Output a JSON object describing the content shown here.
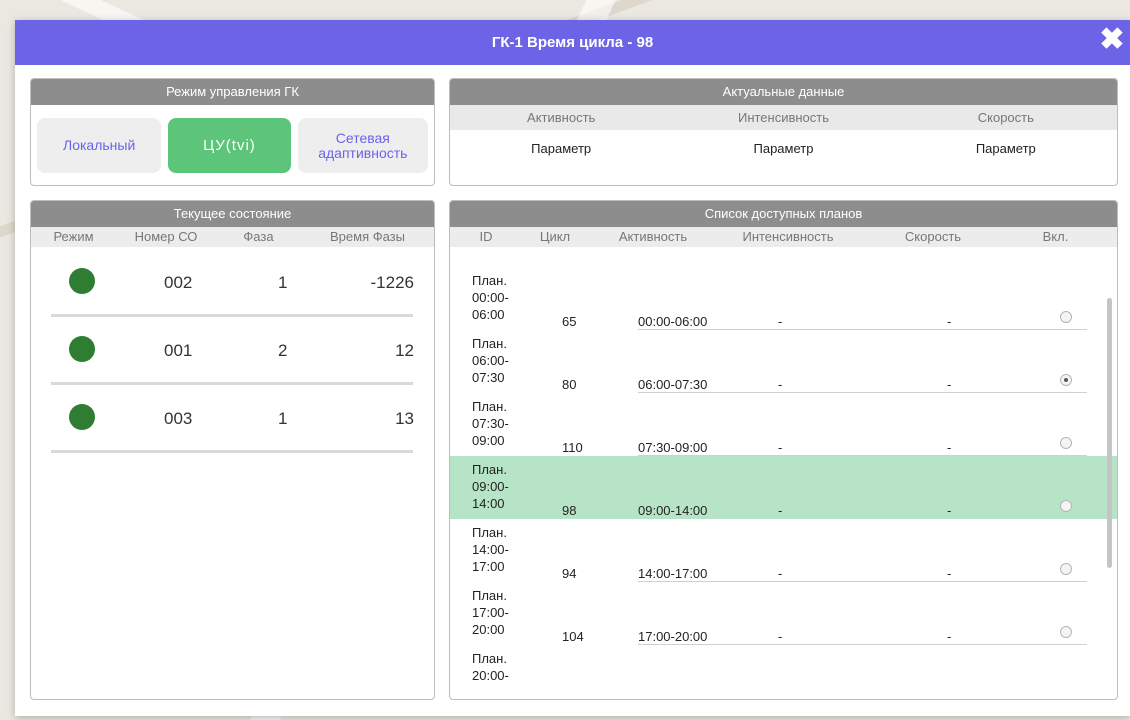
{
  "window": {
    "title": "ГК-1 Время цикла - 98",
    "close_glyph": "✖"
  },
  "mode": {
    "title": "Режим управления ГК",
    "buttons": [
      "Локальный",
      "ЦУ(tvi)",
      "Сетевая адаптивность"
    ],
    "active_index": 1
  },
  "actual": {
    "title": "Актуальные данные",
    "columns": [
      "Активность",
      "Интенсивность",
      "Скорость"
    ],
    "values": [
      "Параметр",
      "Параметр",
      "Параметр"
    ]
  },
  "state": {
    "title": "Текущее состояние",
    "columns": [
      "Режим",
      "Номер СО",
      "Фаза",
      "Время Фазы"
    ],
    "rows": [
      {
        "status": "green",
        "number": "002",
        "phase": "1",
        "time": "-1226"
      },
      {
        "status": "green",
        "number": "001",
        "phase": "2",
        "time": "12"
      },
      {
        "status": "green",
        "number": "003",
        "phase": "1",
        "time": "13"
      }
    ]
  },
  "plans": {
    "title": "Список доступных планов",
    "columns": [
      "ID",
      "Цикл",
      "Активность",
      "Интенсивность",
      "Скорость",
      "Вкл."
    ],
    "rows": [
      {
        "id": [
          "План.",
          "00:00-",
          "06:00"
        ],
        "cycle": "65",
        "activity": "00:00-06:00",
        "intensity": "-",
        "speed": "-",
        "selected": false,
        "highlight": false
      },
      {
        "id": [
          "План.",
          "06:00-",
          "07:30"
        ],
        "cycle": "80",
        "activity": "06:00-07:30",
        "intensity": "-",
        "speed": "-",
        "selected": true,
        "highlight": false
      },
      {
        "id": [
          "План.",
          "07:30-",
          "09:00"
        ],
        "cycle": "110",
        "activity": "07:30-09:00",
        "intensity": "-",
        "speed": "-",
        "selected": false,
        "highlight": false
      },
      {
        "id": [
          "План.",
          "09:00-",
          "14:00"
        ],
        "cycle": "98",
        "activity": "09:00-14:00",
        "intensity": "-",
        "speed": "-",
        "selected": false,
        "highlight": true
      },
      {
        "id": [
          "План.",
          "14:00-",
          "17:00"
        ],
        "cycle": "94",
        "activity": "14:00-17:00",
        "intensity": "-",
        "speed": "-",
        "selected": false,
        "highlight": false
      },
      {
        "id": [
          "План.",
          "17:00-",
          "20:00"
        ],
        "cycle": "104",
        "activity": "17:00-20:00",
        "intensity": "-",
        "speed": "-",
        "selected": false,
        "highlight": false
      },
      {
        "id": [
          "План.",
          "20:00-"
        ],
        "cycle": "",
        "activity": "",
        "intensity": "",
        "speed": "",
        "selected": false,
        "highlight": false
      }
    ]
  },
  "colors": {
    "accent": "#6c63e6",
    "active_mode": "#5cc57a",
    "status_green": "#2e7d32",
    "highlight_row": "#b7e4c7"
  }
}
